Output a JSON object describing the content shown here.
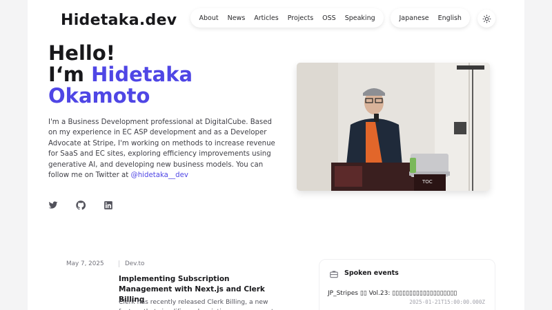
{
  "site": {
    "title": "Hidetaka.dev"
  },
  "nav": {
    "items": [
      {
        "label": "About"
      },
      {
        "label": "News"
      },
      {
        "label": "Articles"
      },
      {
        "label": "Projects"
      },
      {
        "label": "OSS"
      },
      {
        "label": "Speaking"
      }
    ]
  },
  "lang": {
    "items": [
      {
        "label": "Japanese"
      },
      {
        "label": "English"
      }
    ]
  },
  "hero": {
    "greeting": "Hello!",
    "intro": "I‘m ",
    "name_first": "Hidetaka",
    "name_last": "Okamoto",
    "bio": "I'm a Business Development professional at DigitalCube. Based on my experience in EC ASP development and as a Developer Advocate at Stripe, I'm working on methods to increase revenue for SaaS and EC sites, exploring efficiency improvements using generative AI, and developing new business models. You can follow me on Twitter at ",
    "twitter_handle": "@hidetaka__dev"
  },
  "icons": {
    "twitter": "twitter-icon",
    "github": "github-icon",
    "linkedin": "linkedin-icon",
    "theme": "sun-icon",
    "events": "briefcase-icon"
  },
  "article": {
    "date": "May 7, 2025",
    "source": "Dev.to",
    "title": "Implementing Subscription Management with Next.js and Clerk Billing",
    "description": "Clerk has recently released Clerk Billing, a new feature that simplifies subscription management"
  },
  "events": {
    "title": "Spoken events",
    "items": [
      {
        "name": "JP_Stripes ▯▯ Vol.23: ▯▯▯▯▯▯▯▯▯▯▯▯▯▯▯▯▯▯▯",
        "date": "2025-01-21T15:00:00.000Z"
      }
    ]
  },
  "colors": {
    "accent": "#4f46e5",
    "text": "#18181b",
    "muted": "#71717a"
  }
}
